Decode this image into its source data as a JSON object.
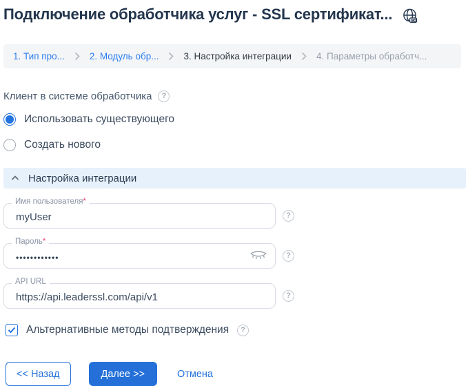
{
  "header": {
    "title": "Подключение обработчика услуг - SSL сертификат...",
    "icon": "globe-link-icon"
  },
  "steps": [
    {
      "label": "1. Тип про...",
      "state": "link"
    },
    {
      "label": "2. Модуль обр...",
      "state": "link"
    },
    {
      "label": "3. Настройка интеграции",
      "state": "current"
    },
    {
      "label": "4. Параметры обработч...",
      "state": "upcoming"
    }
  ],
  "client": {
    "label": "Клиент в системе обработчика",
    "help_icon": "question-circle-icon",
    "options": [
      {
        "label": "Использовать существующего",
        "selected": true
      },
      {
        "label": "Создать нового",
        "selected": false
      }
    ]
  },
  "integration": {
    "title": "Настройка интеграции",
    "collapse_icon": "chevron-up-icon",
    "fields": [
      {
        "label": "Имя пользователя",
        "required_mark": "*",
        "value": "myUser"
      },
      {
        "label": "Пароль",
        "required_mark": "*",
        "value": "••••••••••••",
        "masked": true,
        "eye_icon": "eye-closed-icon"
      },
      {
        "label": "API URL",
        "required_mark": "",
        "value": "https://api.leaderssl.com/api/v1"
      }
    ]
  },
  "confirm": {
    "label": "Альтернативные методы подтверждения",
    "checked": true
  },
  "actions": {
    "back": "<< Назад",
    "next": "Далее >>",
    "cancel": "Отмена"
  },
  "colors": {
    "primary": "#2470d8",
    "step_link": "#2e7ff0",
    "title": "#24364e",
    "section_bg": "#e7f1fc",
    "steps_bg": "#f4f5f7",
    "required": "#e8436f",
    "accent_control": "#2374e1"
  }
}
